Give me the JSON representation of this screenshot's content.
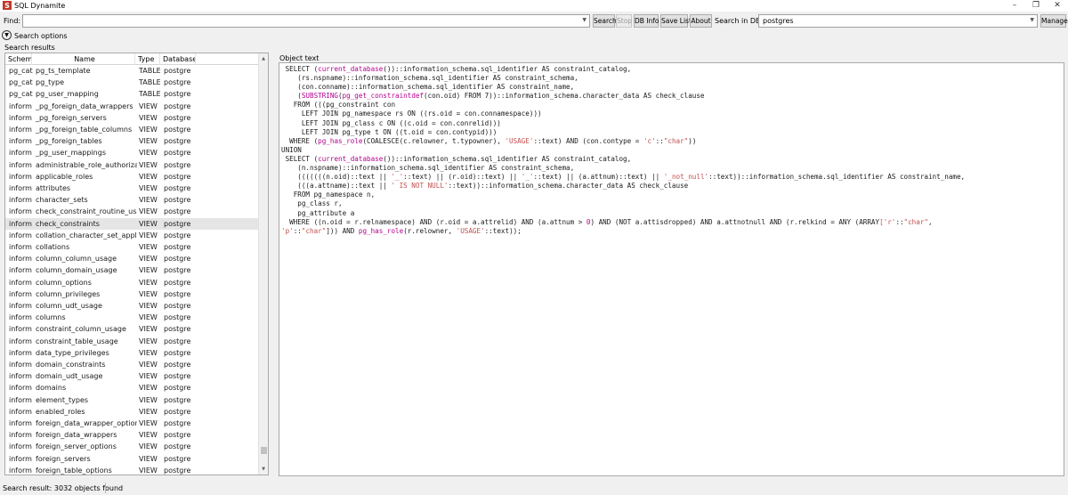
{
  "window": {
    "title": "SQL Dynamite",
    "controls": [
      "minimize",
      "restore",
      "close"
    ],
    "control_glyphs": {
      "minimize": "–",
      "restore": "❐",
      "close": "✕"
    }
  },
  "toolbar": {
    "find_label": "Find:",
    "find_value": "",
    "search_label": "Search",
    "stop_label": "Stop",
    "db_info_label": "DB Info",
    "save_list_label": "Save List",
    "about_label": "About",
    "search_in_db_label": "Search in DB:",
    "db_value": "postgres",
    "manage_label": "Manage"
  },
  "search_options": {
    "label": "Search options"
  },
  "results": {
    "label": "Search results",
    "columns": [
      "Schema",
      "Name",
      "Type",
      "Database"
    ],
    "rows": [
      [
        "pg_cat",
        "pg_ts_template",
        "TABLE",
        "postgre"
      ],
      [
        "pg_cat",
        "pg_type",
        "TABLE",
        "postgre"
      ],
      [
        "pg_cat",
        "pg_user_mapping",
        "TABLE",
        "postgre"
      ],
      [
        "inform",
        "_pg_foreign_data_wrappers",
        "VIEW",
        "postgre"
      ],
      [
        "inform",
        "_pg_foreign_servers",
        "VIEW",
        "postgre"
      ],
      [
        "inform",
        "_pg_foreign_table_columns",
        "VIEW",
        "postgre"
      ],
      [
        "inform",
        "_pg_foreign_tables",
        "VIEW",
        "postgre"
      ],
      [
        "inform",
        "_pg_user_mappings",
        "VIEW",
        "postgre"
      ],
      [
        "inform",
        "administrable_role_authorizatio",
        "VIEW",
        "postgre"
      ],
      [
        "inform",
        "applicable_roles",
        "VIEW",
        "postgre"
      ],
      [
        "inform",
        "attributes",
        "VIEW",
        "postgre"
      ],
      [
        "inform",
        "character_sets",
        "VIEW",
        "postgre"
      ],
      [
        "inform",
        "check_constraint_routine_usage",
        "VIEW",
        "postgre"
      ],
      [
        "inform",
        "check_constraints",
        "VIEW",
        "postgre"
      ],
      [
        "inform",
        "collation_character_set_applicat",
        "VIEW",
        "postgre"
      ],
      [
        "inform",
        "collations",
        "VIEW",
        "postgre"
      ],
      [
        "inform",
        "column_column_usage",
        "VIEW",
        "postgre"
      ],
      [
        "inform",
        "column_domain_usage",
        "VIEW",
        "postgre"
      ],
      [
        "inform",
        "column_options",
        "VIEW",
        "postgre"
      ],
      [
        "inform",
        "column_privileges",
        "VIEW",
        "postgre"
      ],
      [
        "inform",
        "column_udt_usage",
        "VIEW",
        "postgre"
      ],
      [
        "inform",
        "columns",
        "VIEW",
        "postgre"
      ],
      [
        "inform",
        "constraint_column_usage",
        "VIEW",
        "postgre"
      ],
      [
        "inform",
        "constraint_table_usage",
        "VIEW",
        "postgre"
      ],
      [
        "inform",
        "data_type_privileges",
        "VIEW",
        "postgre"
      ],
      [
        "inform",
        "domain_constraints",
        "VIEW",
        "postgre"
      ],
      [
        "inform",
        "domain_udt_usage",
        "VIEW",
        "postgre"
      ],
      [
        "inform",
        "domains",
        "VIEW",
        "postgre"
      ],
      [
        "inform",
        "element_types",
        "VIEW",
        "postgre"
      ],
      [
        "inform",
        "enabled_roles",
        "VIEW",
        "postgre"
      ],
      [
        "inform",
        "foreign_data_wrapper_options",
        "VIEW",
        "postgre"
      ],
      [
        "inform",
        "foreign_data_wrappers",
        "VIEW",
        "postgre"
      ],
      [
        "inform",
        "foreign_server_options",
        "VIEW",
        "postgre"
      ],
      [
        "inform",
        "foreign_servers",
        "VIEW",
        "postgre"
      ],
      [
        "inform",
        "foreign_table_options",
        "VIEW",
        "postgre"
      ]
    ],
    "selected_row": 13
  },
  "object_text": {
    "label": "Object text",
    "lines": [
      " SELECT ({{current_database}}())::information_schema.sql_identifier AS constraint_catalog,",
      "    (rs.nspname)::information_schema.sql_identifier AS constraint_schema,",
      "    (con.conname)::information_schema.sql_identifier AS constraint_name,",
      "    ({{SUBSTRING}}({{pg_get_constraintdef}}(con.oid) FROM 7))::information_schema.character_data AS check_clause",
      "   FROM (((pg_constraint con",
      "     LEFT JOIN pg_namespace rs ON ((rs.oid = con.connamespace)))",
      "     LEFT JOIN pg_class c ON ((c.oid = con.conrelid)))",
      "     LEFT JOIN pg_type t ON ((t.oid = con.contypid)))",
      "  WHERE ({{pg_has_role}}(COALESCE(c.relowner, t.typowner), [['USAGE']]::text) AND (con.contype = [['c']]::[[\"char\"]]))",
      "UNION",
      " SELECT ({{current_database}}())::information_schema.sql_identifier AS constraint_catalog,",
      "    (n.nspname)::information_schema.sql_identifier AS constraint_schema,",
      "    (((((((n.oid)::text || [['_']]::text) || (r.oid)::text) || [['_']]::text) || (a.attnum)::text) || [['_not_null']]::text))::information_schema.sql_identifier AS constraint_name,",
      "    (((a.attname)::text || [[' IS NOT NULL']]::text))::information_schema.character_data AS check_clause",
      "   FROM pg_namespace n,",
      "    pg_class r,",
      "    pg_attribute a",
      "  WHERE ((n.oid = r.relnamespace) AND (r.oid = a.attrelid) AND (a.attnum > {{0}}) AND (NOT a.attisdropped) AND a.attnotnull AND (r.relkind = ANY (ARRAY[[['r']]::[[\"char\"]],",
      "[['p']]::[[\"char\"]]])) AND {{pg_has_role}}(r.relowner, [['USAGE']]::text));"
    ]
  },
  "status": {
    "text": "Search result:  3032 objects found"
  }
}
